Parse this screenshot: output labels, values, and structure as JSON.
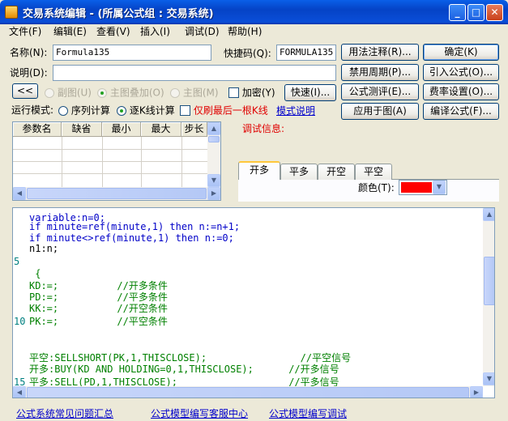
{
  "window": {
    "title": "交易系统编辑 - (所属公式组 : 交易系统)",
    "min": "_",
    "max": "□",
    "close": "✕"
  },
  "menu": [
    "文件(F)",
    "编辑(E)",
    "查看(V)",
    "插入(I)",
    "调试(D)",
    "帮助(H)"
  ],
  "form": {
    "name_label": "名称(N):",
    "name_value": "Formula135",
    "shortcut_label": "快捷码(Q):",
    "shortcut_value": "FORMULA135",
    "desc_label": "说明(D):",
    "desc_value": "",
    "collapse_button": "<<",
    "radio_sub": "副图(U)",
    "radio_main_overlay": "主图叠加(O)",
    "radio_main": "主图(M)",
    "encrypt_label": "加密(Y)",
    "quick_button": "快速(I)...",
    "run_mode_label": "运行模式:",
    "run_sequential": "序列计算",
    "run_tick": "逐K线计算",
    "refresh_last_label": "仅刷最后一根K线",
    "mode_help_link": "模式说明"
  },
  "right_buttons": {
    "usage_note": "用法注释(R)...",
    "ok": "确定(K)",
    "disable_period": "禁用周期(P)...",
    "import_formula": "引入公式(O)...",
    "formula_test": "公式测评(E)...",
    "fee_settings": "费率设置(O)...",
    "apply_chart": "应用于图(A)",
    "compile": "编译公式(F)..."
  },
  "param_table": {
    "headers": [
      "参数名",
      "缺省",
      "最小",
      "最大",
      "步长"
    ]
  },
  "debug": {
    "label": "调试信息:"
  },
  "signal_tabs": [
    "开多",
    "平多",
    "开空",
    "平空"
  ],
  "color": {
    "label": "颜色(T):",
    "value": "#FF0000"
  },
  "code": {
    "lines": [
      {
        "n": "",
        "parts": [
          {
            "c": "blue",
            "t": "variable:n=0;"
          }
        ]
      },
      {
        "n": "",
        "parts": [
          {
            "c": "blue",
            "t": "if minute=ref(minute,1) then n:=n+1;"
          }
        ]
      },
      {
        "n": "",
        "parts": [
          {
            "c": "blue",
            "t": "if minute<>ref(minute,1) then n:=0;"
          }
        ]
      },
      {
        "n": "",
        "parts": [
          {
            "c": "black",
            "t": "n1:n;"
          }
        ]
      },
      {
        "n": "5",
        "parts": [
          {
            "c": "black",
            "t": ""
          }
        ]
      },
      {
        "n": "",
        "parts": [
          {
            "c": "green",
            "t": " {"
          }
        ]
      },
      {
        "n": "",
        "parts": [
          {
            "c": "green",
            "t": "KD:=;          //开多条件"
          }
        ]
      },
      {
        "n": "",
        "parts": [
          {
            "c": "green",
            "t": "PD:=;          //平多条件"
          }
        ]
      },
      {
        "n": "",
        "parts": [
          {
            "c": "green",
            "t": "KK:=;          //开空条件"
          }
        ]
      },
      {
        "n": "10",
        "parts": [
          {
            "c": "green",
            "t": "PK:=;          //平空条件"
          }
        ]
      },
      {
        "n": "",
        "parts": [
          {
            "c": "black",
            "t": ""
          }
        ]
      },
      {
        "n": "",
        "parts": [
          {
            "c": "black",
            "t": ""
          }
        ]
      },
      {
        "n": "",
        "parts": [
          {
            "c": "green",
            "t": "平空:SELLSHORT(PK,1,THISCLOSE);                //平空信号"
          }
        ]
      },
      {
        "n": "",
        "parts": [
          {
            "c": "green",
            "t": "开多:BUY(KD AND HOLDING=0,1,THISCLOSE);      //开多信号"
          }
        ]
      },
      {
        "n": "15",
        "parts": [
          {
            "c": "green",
            "t": "平多:SELL(PD,1,THISCLOSE);                   //平多信号"
          }
        ]
      }
    ]
  },
  "footer_links": [
    "公式系统常见问题汇总",
    "公式模型编写客服中心",
    "公式模型编写调试"
  ]
}
